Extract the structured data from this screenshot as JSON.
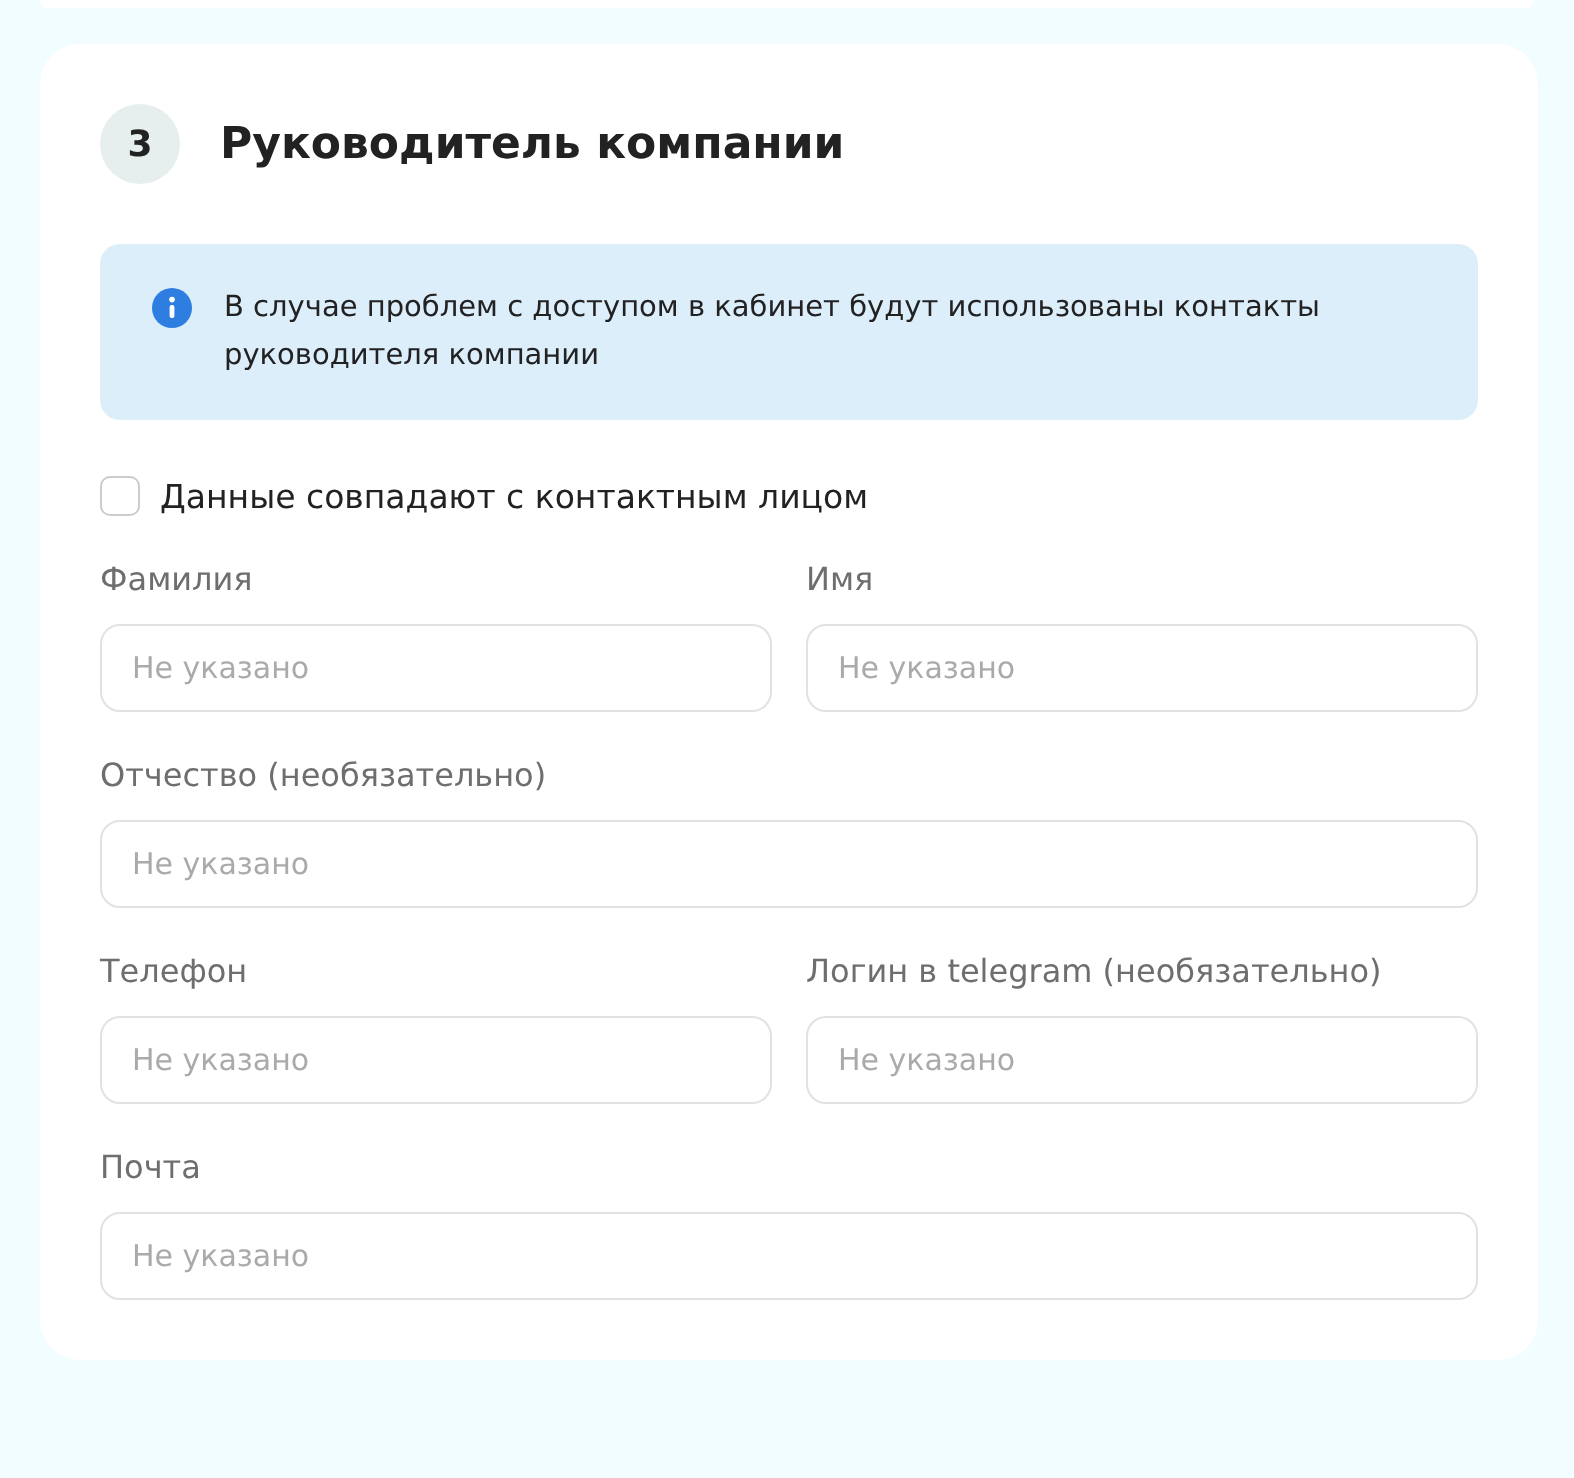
{
  "section": {
    "step": "3",
    "title": "Руководитель компании"
  },
  "notice": {
    "text": "В случае проблем с доступом в кабинет будут использованы контакты руководителя компании"
  },
  "same_as_contact": {
    "label": "Данные совпадают с контактным лицом",
    "checked": false
  },
  "rows": [
    {
      "fields": [
        {
          "label": "Фамилия",
          "placeholder": "Не указано"
        },
        {
          "label": "Имя",
          "placeholder": "Не указано"
        }
      ]
    },
    {
      "fields": [
        {
          "label": "Отчество (необязательно)",
          "placeholder": "Не указано"
        }
      ]
    },
    {
      "fields": [
        {
          "label": "Телефон",
          "placeholder": "Не указано"
        },
        {
          "label": "Логин в telegram (необязательно)",
          "placeholder": "Не указано"
        }
      ]
    },
    {
      "fields": [
        {
          "label": "Почта",
          "placeholder": "Не указано"
        }
      ]
    }
  ]
}
